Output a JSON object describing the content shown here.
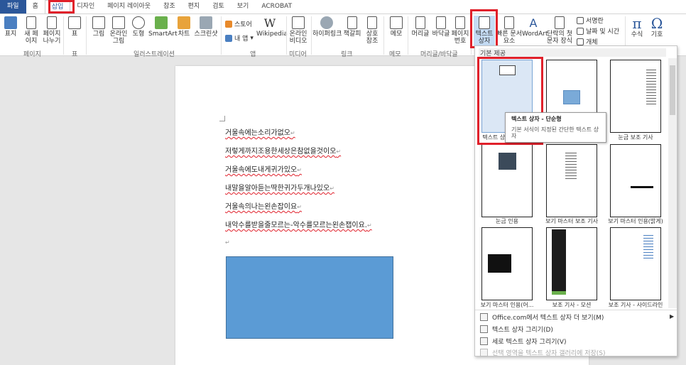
{
  "tabs": [
    "파일",
    "홈",
    "삽입",
    "디자인",
    "페이지 레이아웃",
    "참조",
    "편지",
    "검토",
    "보기",
    "ACROBAT"
  ],
  "active_tab": "삽입",
  "ribbon": {
    "pages": {
      "cover": "표지",
      "blank": "새 페\n이지",
      "break": "페이지\n나누기",
      "label": "페이지"
    },
    "table": {
      "table": "표",
      "label": "표"
    },
    "illustrations": {
      "picture": "그림",
      "online": "온라인\n그림",
      "shapes": "도형",
      "smartart": "SmartArt",
      "chart": "차트",
      "screenshot": "스크린샷",
      "label": "일러스트레이션"
    },
    "apps": {
      "store": "스토어",
      "myapps": "내 앱",
      "wikipedia": "Wikipedia",
      "label": "앱"
    },
    "media": {
      "video": "온라인\n비디오",
      "label": "미디어"
    },
    "links": {
      "hyperlink": "하이퍼링크",
      "bookmark": "책갈피",
      "crossref": "상호\n참조",
      "label": "링크"
    },
    "comments": {
      "comment": "메모",
      "label": "메모"
    },
    "headerfooter": {
      "header": "머리글",
      "footer": "바닥글",
      "pagenum": "페이지\n번호",
      "label": "머리글/바닥글"
    },
    "text": {
      "textbox": "텍스트\n상자",
      "quickparts": "빠른 문서\n요소",
      "wordart": "WordArt",
      "dropcap": "단락의 첫\n문자 장식",
      "signature": "서명란",
      "datetime": "날짜 및 시간",
      "object": "개체"
    },
    "symbols": {
      "equation": "수식",
      "symbol": "기호"
    }
  },
  "document": {
    "lines": [
      "거울속에는소리가없오",
      "저렇게까지조용한세상은참없을것이오",
      "거울속에도내게귀가있오",
      "내말을알아듣는딱한귀가두개나있오",
      "거울속의나는왼손잡이요",
      "내악수를받을줄모르는-악수를모르는왼손잽이요."
    ],
    "para_mark": "↵"
  },
  "gallery": {
    "header": "기본 제공",
    "items": [
      "텍스트 상자 - 단순형",
      "",
      "눈금 보조 기사",
      "눈금 인용",
      "보기 마스터 보조 기사",
      "보기 마스터 인용(밝게)",
      "보기 마스터 인용(어...",
      "보조 기사 - 모션",
      "보조 기사 - 사이드라인"
    ],
    "menu": [
      "Office.com에서 텍스트 상자 더 보기(M)",
      "텍스트 상자 그리기(D)",
      "세로 텍스트 상자 그리기(V)",
      "선택 영역을 텍스트 상자 갤러리에 저장(S)"
    ]
  },
  "tooltip": {
    "title": "텍스트 상자 - 단순형",
    "desc": "기본 서식이 지정된 간단한 텍스트 상자"
  },
  "colors": {
    "accent": "#2b579a",
    "highlight": "#e0202a",
    "shape": "#5b9bd5"
  }
}
